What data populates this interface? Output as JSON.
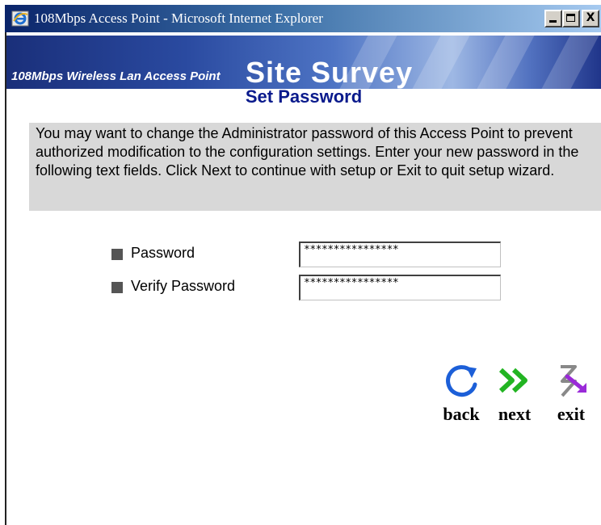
{
  "window": {
    "title": "108Mbps Access Point - Microsoft Internet Explorer",
    "icon": "ie-icon",
    "controls": {
      "minimize_icon": "minimize-icon",
      "maximize_icon": "maximize-icon",
      "close_label": "X"
    }
  },
  "banner": {
    "subtitle": "108Mbps Wireless Lan Access Point",
    "title": "Site Survey"
  },
  "page": {
    "heading": "Set Password",
    "description": "You may want to change the Administrator password of this Access Point to prevent authorized modification to the configuration settings. Enter your new password in the following text fields. Click Next to continue with setup or Exit to quit setup wizard."
  },
  "form": {
    "password": {
      "label": "Password",
      "value": "****************"
    },
    "verify_password": {
      "label": "Verify Password",
      "value": "****************"
    }
  },
  "nav": {
    "back": {
      "label": "back",
      "icon": "circular-arrow-icon"
    },
    "next": {
      "label": "next",
      "icon": "double-chevron-right-icon"
    },
    "exit": {
      "label": "exit",
      "icon": "exit-arrow-icon"
    }
  },
  "colors": {
    "heading": "#0a1a8c",
    "info_background": "#d8d8d8",
    "back_icon": "#1c5fd8",
    "next_icon": "#22b422",
    "exit_icon": "#9a2ad8",
    "bullet": "#555555"
  }
}
